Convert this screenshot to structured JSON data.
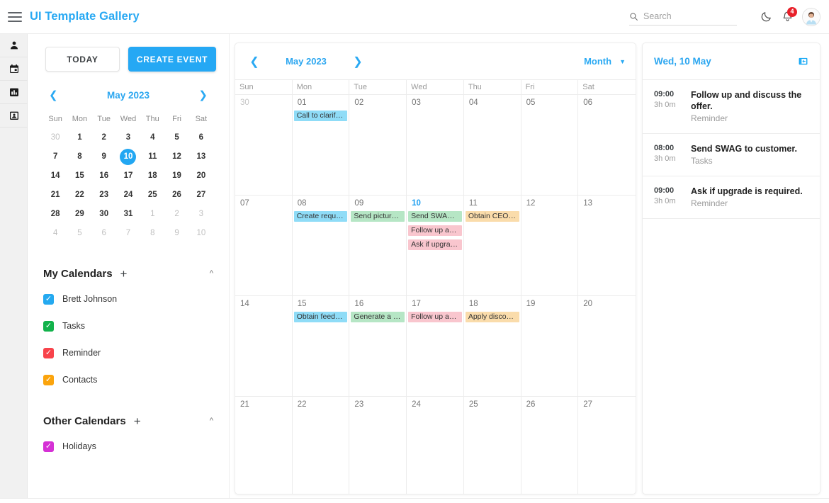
{
  "header": {
    "menu_icon": "hamburger-icon",
    "title": "UI Template Gallery",
    "search": {
      "placeholder": "Search",
      "value": "",
      "icon": "search-icon"
    },
    "theme_toggle_icon": "moon-icon",
    "notifications": {
      "icon": "bell-icon",
      "count": "4"
    },
    "avatar_icon": "user-avatar"
  },
  "rail": {
    "items": [
      {
        "icon": "person-icon",
        "name": "profile"
      },
      {
        "icon": "calendar-icon",
        "name": "calendar"
      },
      {
        "icon": "chart-icon",
        "name": "reports"
      },
      {
        "icon": "contact-card-icon",
        "name": "contacts"
      }
    ]
  },
  "sidebar": {
    "today_label": "TODAY",
    "create_label": "CREATE EVENT",
    "mini_calendar": {
      "title": "May 2023",
      "prev_icon": "chevron-left-icon",
      "next_icon": "chevron-right-icon",
      "dow": [
        "Sun",
        "Mon",
        "Tue",
        "Wed",
        "Thu",
        "Fri",
        "Sat"
      ],
      "weeks": [
        [
          {
            "d": "30",
            "m": true
          },
          {
            "d": "1"
          },
          {
            "d": "2"
          },
          {
            "d": "3"
          },
          {
            "d": "4"
          },
          {
            "d": "5"
          },
          {
            "d": "6"
          }
        ],
        [
          {
            "d": "7"
          },
          {
            "d": "8"
          },
          {
            "d": "9"
          },
          {
            "d": "10",
            "today": true
          },
          {
            "d": "11"
          },
          {
            "d": "12"
          },
          {
            "d": "13"
          }
        ],
        [
          {
            "d": "14"
          },
          {
            "d": "15"
          },
          {
            "d": "16"
          },
          {
            "d": "17"
          },
          {
            "d": "18"
          },
          {
            "d": "19"
          },
          {
            "d": "20"
          }
        ],
        [
          {
            "d": "21"
          },
          {
            "d": "22"
          },
          {
            "d": "23"
          },
          {
            "d": "24"
          },
          {
            "d": "25"
          },
          {
            "d": "26"
          },
          {
            "d": "27"
          }
        ],
        [
          {
            "d": "28"
          },
          {
            "d": "29"
          },
          {
            "d": "30"
          },
          {
            "d": "31"
          },
          {
            "d": "1",
            "m": true
          },
          {
            "d": "2",
            "m": true
          },
          {
            "d": "3",
            "m": true
          }
        ],
        [
          {
            "d": "4",
            "m": true
          },
          {
            "d": "5",
            "m": true
          },
          {
            "d": "6",
            "m": true
          },
          {
            "d": "7",
            "m": true
          },
          {
            "d": "8",
            "m": true
          },
          {
            "d": "9",
            "m": true
          },
          {
            "d": "10",
            "m": true
          }
        ]
      ]
    },
    "my_calendars": {
      "title": "My Calendars",
      "add_icon": "plus-icon",
      "collapse_icon": "chevron-up-icon",
      "items": [
        {
          "label": "Brett Johnson",
          "color": "#24a9f0",
          "checked": true
        },
        {
          "label": "Tasks",
          "color": "#12b24b",
          "checked": true
        },
        {
          "label": "Reminder",
          "color": "#f8434b",
          "checked": true
        },
        {
          "label": "Contacts",
          "color": "#fba40d",
          "checked": true
        }
      ]
    },
    "other_calendars": {
      "title": "Other Calendars",
      "add_icon": "plus-icon",
      "collapse_icon": "chevron-up-icon",
      "items": [
        {
          "label": "Holidays",
          "color": "#d531d5",
          "checked": true
        }
      ]
    }
  },
  "calendar": {
    "prev_icon": "chevron-left-icon",
    "next_icon": "chevron-right-icon",
    "title": "May 2023",
    "view_label": "Month",
    "view_caret_icon": "chevron-down-icon",
    "dow": [
      "Sun",
      "Mon",
      "Tue",
      "Wed",
      "Thu",
      "Fri",
      "Sat"
    ],
    "colors": {
      "blue": "#8fdcf7",
      "green": "#b6e6c5",
      "pink": "#f9c6ce",
      "orange": "#fadcab"
    },
    "weeks": [
      [
        {
          "day": "30",
          "muted": true,
          "events": []
        },
        {
          "day": "01",
          "events": [
            {
              "title": "Call to clarify ...",
              "color": "blue"
            }
          ]
        },
        {
          "day": "02",
          "events": []
        },
        {
          "day": "03",
          "events": []
        },
        {
          "day": "04",
          "events": []
        },
        {
          "day": "05",
          "events": []
        },
        {
          "day": "06",
          "events": []
        }
      ],
      [
        {
          "day": "07",
          "events": []
        },
        {
          "day": "08",
          "events": [
            {
              "title": "Create reques...",
              "color": "blue"
            }
          ]
        },
        {
          "day": "09",
          "events": [
            {
              "title": "Send pictures...",
              "color": "green"
            }
          ]
        },
        {
          "day": "10",
          "today": true,
          "events": [
            {
              "title": "Send SWAG t...",
              "color": "green"
            },
            {
              "title": "Follow up and...",
              "color": "pink"
            },
            {
              "title": "Ask if upgrad...",
              "color": "pink"
            }
          ]
        },
        {
          "day": "11",
          "events": [
            {
              "title": "Obtain CEO c...",
              "color": "orange"
            }
          ]
        },
        {
          "day": "12",
          "events": []
        },
        {
          "day": "13",
          "events": []
        }
      ],
      [
        {
          "day": "14",
          "events": []
        },
        {
          "day": "15",
          "events": [
            {
              "title": "Obtain feedb...",
              "color": "blue"
            }
          ]
        },
        {
          "day": "16",
          "events": [
            {
              "title": "Generate a qu...",
              "color": "green"
            }
          ]
        },
        {
          "day": "17",
          "events": [
            {
              "title": "Follow up and...",
              "color": "pink"
            }
          ]
        },
        {
          "day": "18",
          "events": [
            {
              "title": "Apply discou...",
              "color": "orange"
            }
          ]
        },
        {
          "day": "19",
          "events": []
        },
        {
          "day": "20",
          "events": []
        }
      ],
      [
        {
          "day": "21",
          "events": []
        },
        {
          "day": "22",
          "events": []
        },
        {
          "day": "23",
          "events": []
        },
        {
          "day": "24",
          "events": []
        },
        {
          "day": "25",
          "events": []
        },
        {
          "day": "26",
          "events": []
        },
        {
          "day": "27",
          "events": []
        }
      ]
    ]
  },
  "agenda": {
    "date_label": "Wed, 10 May",
    "collapse_icon": "collapse-panel-icon",
    "items": [
      {
        "time": "09:00",
        "duration": "3h 0m",
        "title": "Follow up and discuss the offer.",
        "category": "Reminder"
      },
      {
        "time": "08:00",
        "duration": "3h 0m",
        "title": "Send SWAG to customer.",
        "category": "Tasks"
      },
      {
        "time": "09:00",
        "duration": "3h 0m",
        "title": "Ask if upgrade is required.",
        "category": "Reminder"
      }
    ]
  }
}
